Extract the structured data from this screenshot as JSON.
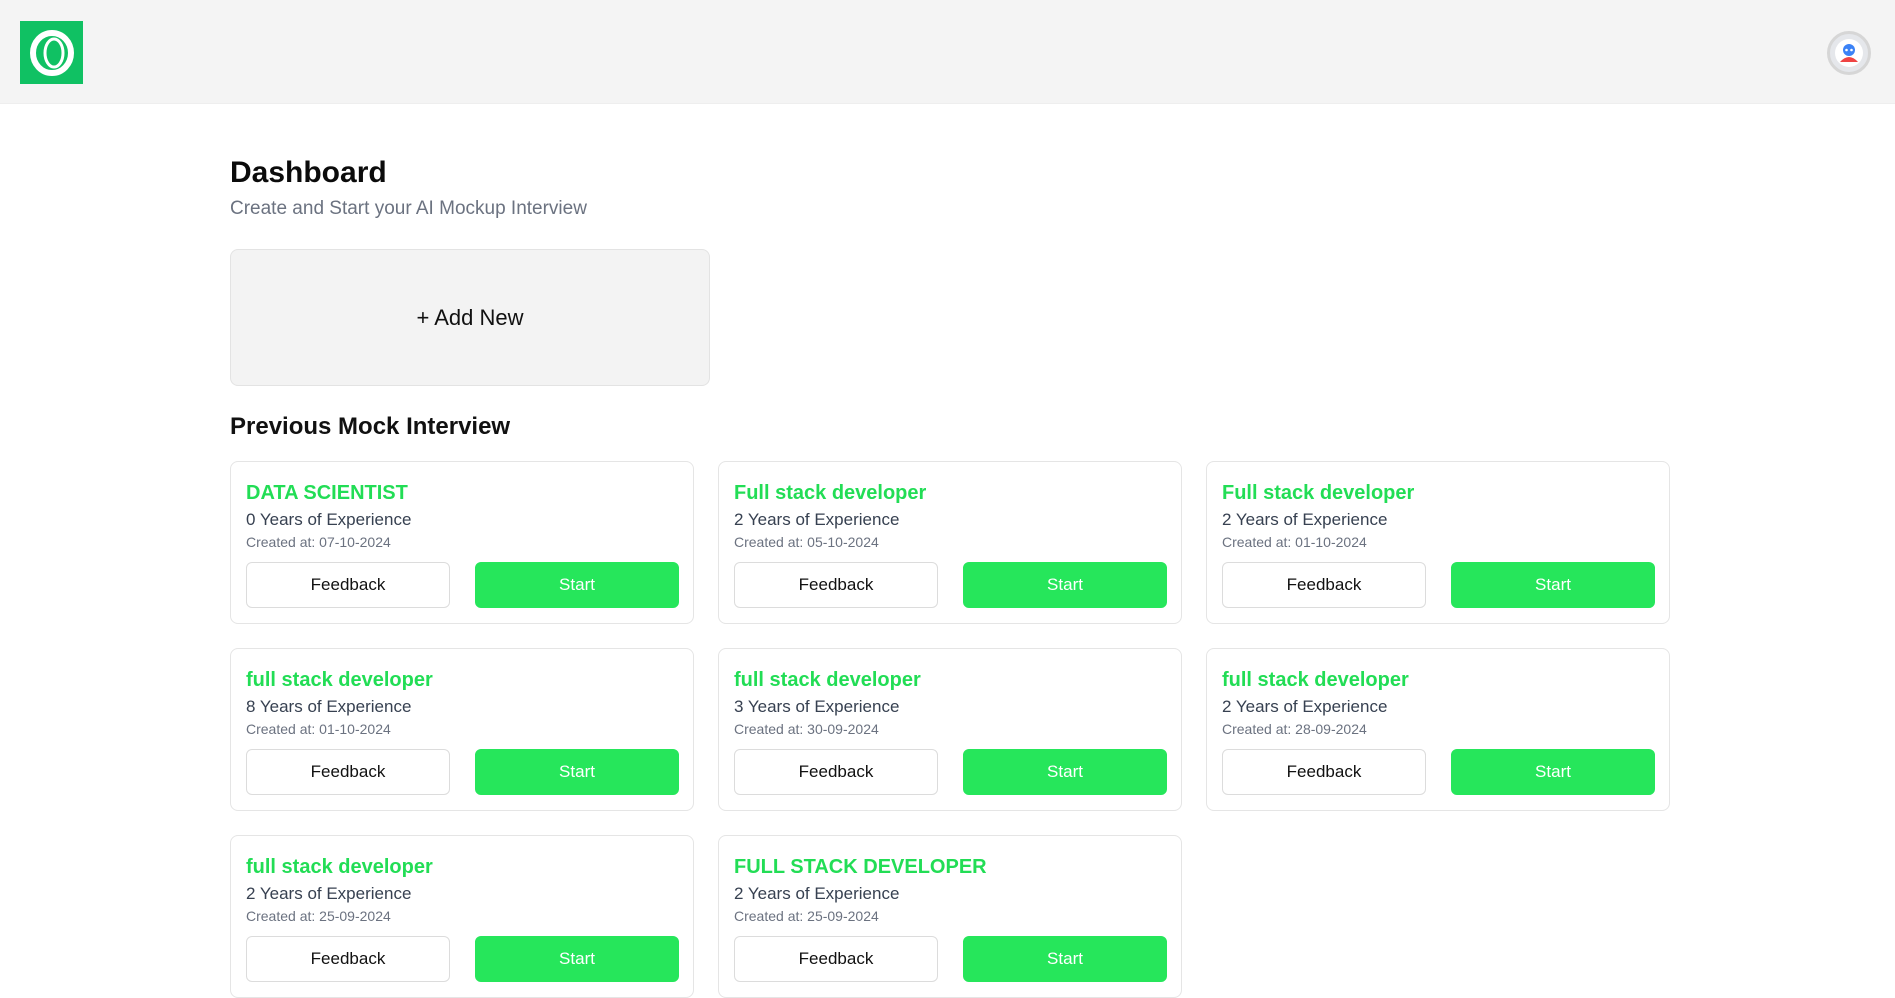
{
  "header": {
    "logo_icon": "logo-ring-icon",
    "avatar_icon": "user-avatar-icon",
    "brand_color": "#10c163"
  },
  "dashboard": {
    "title": "Dashboard",
    "subtitle": "Create and Start your AI Mockup Interview",
    "add_new_label": "+ Add New"
  },
  "previous": {
    "section_title": "Previous Mock Interview",
    "feedback_label": "Feedback",
    "start_label": "Start",
    "accent_color": "#26e65b",
    "interviews": [
      {
        "role": "DATA SCIENTIST",
        "experience": "0 Years of Experience",
        "created": "Created at: 07-10-2024"
      },
      {
        "role": "Full stack developer",
        "experience": "2 Years of Experience",
        "created": "Created at: 05-10-2024"
      },
      {
        "role": "Full stack developer",
        "experience": "2 Years of Experience",
        "created": "Created at: 01-10-2024"
      },
      {
        "role": "full stack developer",
        "experience": "8 Years of Experience",
        "created": "Created at: 01-10-2024"
      },
      {
        "role": "full stack developer",
        "experience": "3 Years of Experience",
        "created": "Created at: 30-09-2024"
      },
      {
        "role": "full stack developer",
        "experience": "2 Years of Experience",
        "created": "Created at: 28-09-2024"
      },
      {
        "role": "full stack developer",
        "experience": "2 Years of Experience",
        "created": "Created at: 25-09-2024"
      },
      {
        "role": "FULL STACK DEVELOPER",
        "experience": "2 Years of Experience",
        "created": "Created at: 25-09-2024"
      }
    ]
  }
}
